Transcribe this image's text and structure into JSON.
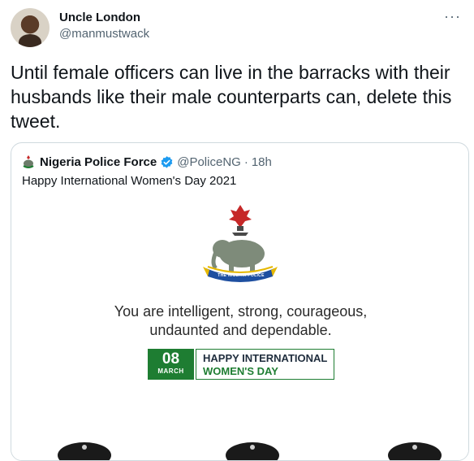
{
  "tweet": {
    "author_name": "Uncle London",
    "author_handle": "@manmustwack",
    "more_icon": "more-horizontal-icon",
    "text": "Until female officers can live in the barracks with their husbands like their male counterparts can, delete this tweet."
  },
  "quote": {
    "author_name": "Nigeria Police Force",
    "verified_icon": "verified-badge-icon",
    "author_handle": "@PoliceNG",
    "separator": "·",
    "time": "18h",
    "text": "Happy International Women's Day 2021",
    "image": {
      "emblem_text": "THE NIGERIA POLICE",
      "slogan_line1": "You are intelligent, strong, courageous,",
      "slogan_line2": "undaunted and dependable.",
      "date_day": "08",
      "date_month": "MARCH",
      "banner_line1": "HAPPY INTERNATIONAL",
      "banner_line2": "WOMEN'S DAY"
    }
  },
  "colors": {
    "text_primary": "#0f1419",
    "text_secondary": "#536471",
    "border": "#cfd9de",
    "verified": "#1d9bf0",
    "accent_green": "#1e7d32"
  }
}
